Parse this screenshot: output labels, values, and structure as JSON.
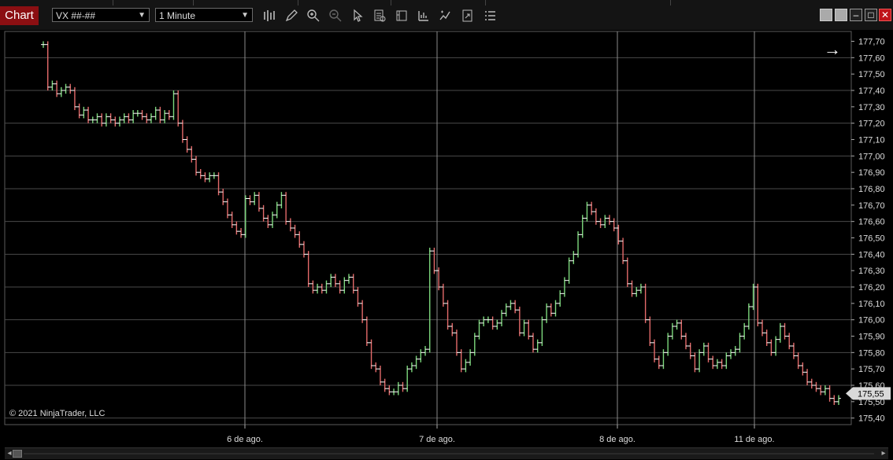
{
  "toolbar": {
    "tab_label": "Chart",
    "instrument": "VX ##-##",
    "interval": "1 Minute",
    "tools": [
      "bar-type-icon",
      "pencil-icon",
      "zoom-in-icon",
      "zoom-out-icon",
      "cursor-icon",
      "data-box-icon",
      "properties-icon",
      "indicators-icon",
      "strategies-icon",
      "templates-icon",
      "list-icon"
    ]
  },
  "watermark": "© 2021 NinjaTrader, LLC",
  "price_marker": "175,55",
  "colors": {
    "up": "#7cd87c",
    "down": "#e46a6a",
    "bar": "#ffffff",
    "grid": "#4a4a4a",
    "marker_bg": "#d9d9d9"
  },
  "chart_data": {
    "type": "ohlc",
    "y_tick_labels": [
      "177,70",
      "177,60",
      "177,50",
      "177,40",
      "177,30",
      "177,20",
      "177,10",
      "177,00",
      "176,90",
      "176,80",
      "176,70",
      "176,60",
      "176,50",
      "176,40",
      "176,30",
      "176,20",
      "176,10",
      "176,00",
      "175,90",
      "175,80",
      "175,70",
      "175,60",
      "175,50",
      "175,40"
    ],
    "ylim": [
      175.36,
      177.76
    ],
    "x_tick_labels": [
      "6 de ago.",
      "7 de ago.",
      "8 de ago.",
      "11 de ago."
    ],
    "last_price": 175.55,
    "series": [
      {
        "name": "VX ##-##",
        "values": [
          177.68,
          177.42,
          177.44,
          177.38,
          177.4,
          177.42,
          177.4,
          177.3,
          177.25,
          177.28,
          177.22,
          177.22,
          177.24,
          177.2,
          177.24,
          177.22,
          177.2,
          177.22,
          177.24,
          177.22,
          177.26,
          177.26,
          177.24,
          177.22,
          177.24,
          177.28,
          177.22,
          177.26,
          177.24,
          177.38,
          177.2,
          177.1,
          177.04,
          176.98,
          176.9,
          176.88,
          176.86,
          176.88,
          176.88,
          176.78,
          176.72,
          176.64,
          176.58,
          176.54,
          176.52,
          176.74,
          176.72,
          176.76,
          176.68,
          176.62,
          176.58,
          176.64,
          176.7,
          176.76,
          176.6,
          176.56,
          176.52,
          176.46,
          176.4,
          176.22,
          176.18,
          176.2,
          176.18,
          176.22,
          176.26,
          176.22,
          176.18,
          176.24,
          176.26,
          176.18,
          176.1,
          176.0,
          175.86,
          175.72,
          175.7,
          175.62,
          175.58,
          175.56,
          175.56,
          175.6,
          175.58,
          175.7,
          175.72,
          175.76,
          175.8,
          175.82,
          176.42,
          176.3,
          176.2,
          176.1,
          175.96,
          175.92,
          175.8,
          175.7,
          175.74,
          175.8,
          175.9,
          175.98,
          176.0,
          176.0,
          175.96,
          175.98,
          176.04,
          176.08,
          176.1,
          176.06,
          175.92,
          175.98,
          175.9,
          175.82,
          175.86,
          176.0,
          176.08,
          176.04,
          176.1,
          176.16,
          176.24,
          176.36,
          176.4,
          176.52,
          176.62,
          176.7,
          176.66,
          176.6,
          176.58,
          176.62,
          176.6,
          176.56,
          176.48,
          176.36,
          176.22,
          176.16,
          176.18,
          176.2,
          176.0,
          175.86,
          175.76,
          175.72,
          175.8,
          175.9,
          175.96,
          175.98,
          175.9,
          175.84,
          175.78,
          175.7,
          175.8,
          175.84,
          175.76,
          175.72,
          175.74,
          175.72,
          175.78,
          175.8,
          175.82,
          175.9,
          175.96,
          176.08,
          176.2,
          175.98,
          175.92,
          175.86,
          175.8,
          175.88,
          175.96,
          175.9,
          175.84,
          175.78,
          175.72,
          175.68,
          175.62,
          175.6,
          175.58,
          175.56,
          175.58,
          175.52,
          175.5,
          175.52
        ]
      }
    ]
  }
}
